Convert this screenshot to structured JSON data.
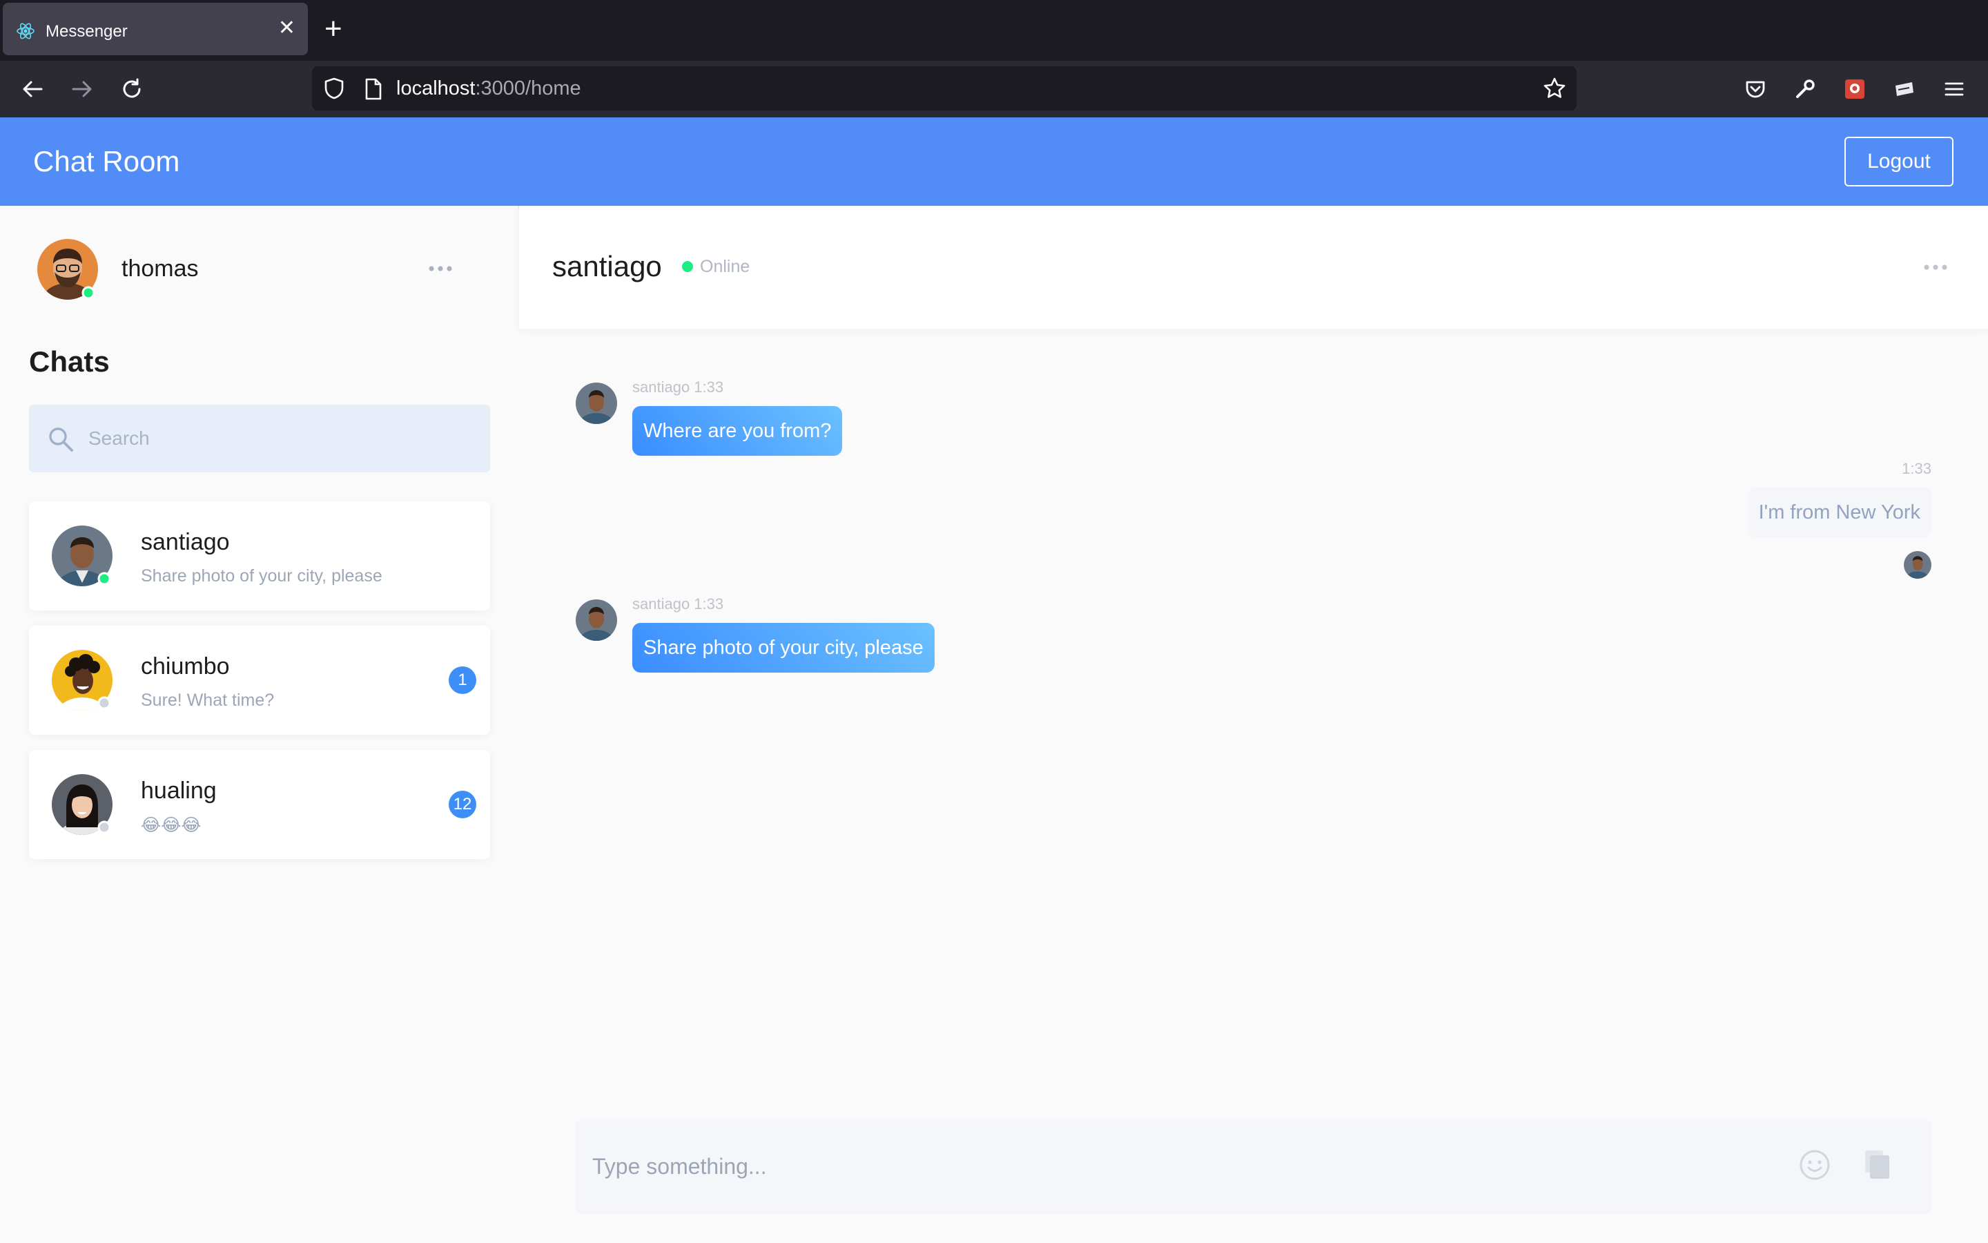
{
  "browser": {
    "tab_title": "Messenger",
    "url_host": "localhost",
    "url_path": ":3000/home"
  },
  "header": {
    "title": "Chat Room",
    "logout_label": "Logout",
    "color": "#528df7"
  },
  "me": {
    "username": "thomas",
    "status": "online"
  },
  "sidebar": {
    "chats_title": "Chats",
    "search_placeholder": "Search",
    "conversations": [
      {
        "name": "santiago",
        "preview": "Share photo of your city, please",
        "online": true,
        "unread": null
      },
      {
        "name": "chiumbo",
        "preview": "Sure! What time?",
        "online": false,
        "unread": "1"
      },
      {
        "name": "hualing",
        "preview": "😂😂😂",
        "online": false,
        "unread": "12"
      }
    ]
  },
  "chat": {
    "partner": "santiago",
    "status": "Online",
    "messages": [
      {
        "from": "santiago",
        "meta": "santiago 1:33",
        "text": "Where are you from?",
        "direction": "in"
      },
      {
        "from": "thomas",
        "meta": "1:33",
        "text": "I'm from New York",
        "direction": "out"
      },
      {
        "from": "santiago",
        "meta": "santiago 1:33",
        "text": "Share photo of your city, please",
        "direction": "in"
      }
    ],
    "composer_placeholder": "Type something..."
  },
  "colors": {
    "accent": "#3e8ef7",
    "online": "#1ced84",
    "offline": "#d0d5dd"
  }
}
